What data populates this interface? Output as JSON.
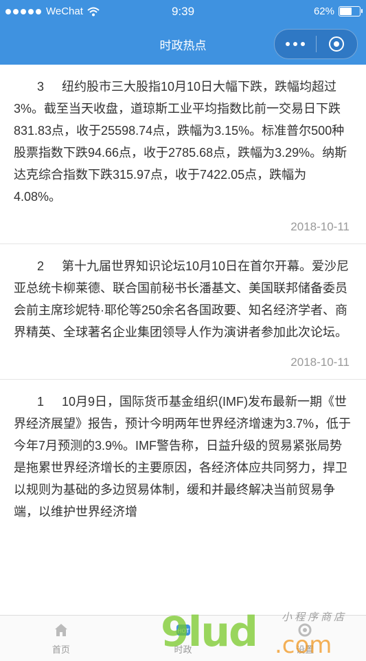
{
  "status_bar": {
    "carrier": "WeChat",
    "time": "9:39",
    "battery_text": "62%",
    "battery_level": 0.62
  },
  "nav": {
    "title": "时政热点"
  },
  "news": [
    {
      "number": "3",
      "text": "纽约股市三大股指10月10日大幅下跌，跌幅均超过3%。截至当天收盘，道琼斯工业平均指数比前一交易日下跌831.83点，收于25598.74点，跌幅为3.15%。标准普尔500种股票指数下跌94.66点，收于2785.68点，跌幅为3.29%。纳斯达克综合指数下跌315.97点，收于7422.05点，跌幅为4.08%。",
      "date": "2018-10-11"
    },
    {
      "number": "2",
      "text": "第十九届世界知识论坛10月10日在首尔开幕。爱沙尼亚总统卡柳莱德、联合国前秘书长潘基文、美国联邦储备委员会前主席珍妮特·耶伦等250余名各国政要、知名经济学者、商界精英、全球著名企业集团领导人作为演讲者参加此次论坛。",
      "date": "2018-10-11"
    },
    {
      "number": "1",
      "text": "10月9日，国际货币基金组织(IMF)发布最新一期《世界经济展望》报告，预计今明两年世界经济增速为3.7%，低于今年7月预测的3.9%。IMF警告称，日益升级的贸易紧张局势是拖累世界经济增长的主要原因，各经济体应共同努力，捍卫以规则为基础的多边贸易体制，缓和并最终解决当前贸易争端，以维护世界经济增",
      "date": ""
    }
  ],
  "tabbar": {
    "tabs": [
      {
        "label": "首页",
        "icon": "home-icon"
      },
      {
        "label": "时政",
        "icon": "hot-icon"
      },
      {
        "label": "设置",
        "icon": "settings-icon"
      }
    ]
  },
  "watermark": {
    "brand": "9lud",
    "suffix": ".com",
    "tagline": "小程序商店"
  },
  "colors": {
    "nav_bg": "#3f92e0",
    "text": "#333333",
    "date": "#999999"
  }
}
